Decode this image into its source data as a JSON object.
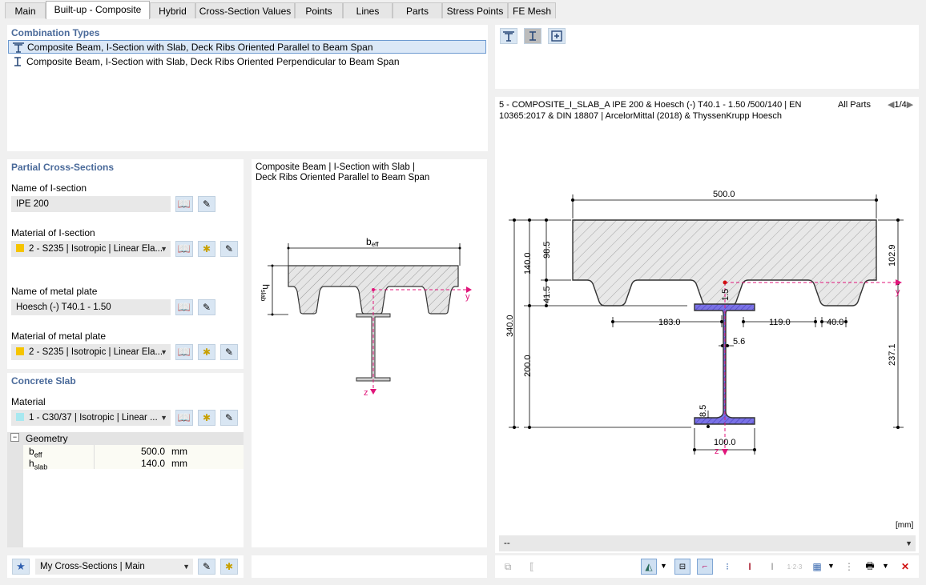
{
  "tabs": [
    "Main",
    "Built-up - Composite",
    "Hybrid",
    "Cross-Section Values",
    "Points",
    "Lines",
    "Parts",
    "Stress Points",
    "FE Mesh"
  ],
  "active_tab": "Built-up - Composite",
  "combination_types": {
    "title": "Combination Types",
    "items": [
      {
        "label": "Composite Beam, I-Section with Slab, Deck Ribs Oriented Parallel to Beam Span",
        "selected": true
      },
      {
        "label": "Composite Beam, I-Section with Slab, Deck Ribs Oriented Perpendicular to Beam Span",
        "selected": false
      }
    ]
  },
  "partial": {
    "title": "Partial Cross-Sections",
    "name_i_label": "Name of I-section",
    "name_i_value": "IPE 200",
    "mat_i_label": "Material of I-section",
    "mat_i_value": "2 - S235 | Isotropic | Linear Ela...",
    "mat_i_color": "#f5c400",
    "name_plate_label": "Name of metal plate",
    "name_plate_value": "Hoesch (-) T40.1 - 1.50",
    "mat_plate_label": "Material of metal plate",
    "mat_plate_value": "2 - S235 | Isotropic | Linear Ela...",
    "mat_plate_color": "#f5c400"
  },
  "concrete": {
    "title": "Concrete Slab",
    "mat_label": "Material",
    "mat_value": "1 - C30/37 | Isotropic | Linear ...",
    "mat_color": "#a8e8f0",
    "geometry_label": "Geometry",
    "rows": [
      {
        "name": "b",
        "sub": "eff",
        "value": "500.0",
        "unit": "mm"
      },
      {
        "name": "h",
        "sub": "slab",
        "value": "140.0",
        "unit": "mm"
      }
    ]
  },
  "schematic": {
    "title_line1": "Composite Beam | I-Section with Slab |",
    "title_line2": "Deck Ribs Oriented Parallel to Beam Span",
    "beff_label": "b",
    "beff_sub": "eff",
    "hslab_label": "h",
    "hslab_sub": "slab",
    "y_label": "y",
    "z_label": "z"
  },
  "bottom_left": {
    "dropdown": "My Cross-Sections | Main"
  },
  "section_info": {
    "line1": "5 - COMPOSITE_I_SLAB_A IPE 200 & Hoesch (-) T40.1 - 1.50 /500/140 | EN",
    "line2": "10365:2017 & DIN 18807 | ArcelorMittal (2018) & ThyssenKrupp Hoesch",
    "parts_label": "All Parts",
    "page": "1/4"
  },
  "drawing": {
    "dim_width": "500.0",
    "dim_slab": "140.0",
    "dim_985": "98.5",
    "dim_415": "41.5",
    "dim_total": "340.0",
    "dim_200": "200.0",
    "dim_right_top": "102.9",
    "dim_right_bottom": "237.1",
    "dim_15": "1.5",
    "dim_183": "183.0",
    "dim_119": "119.0",
    "dim_40": "40.0",
    "dim_56": "5.6",
    "dim_85": "8.5",
    "dim_100": "100.0",
    "y_label": "y",
    "z_label": "z",
    "unit": "[mm]"
  },
  "right_dropdown": "--"
}
